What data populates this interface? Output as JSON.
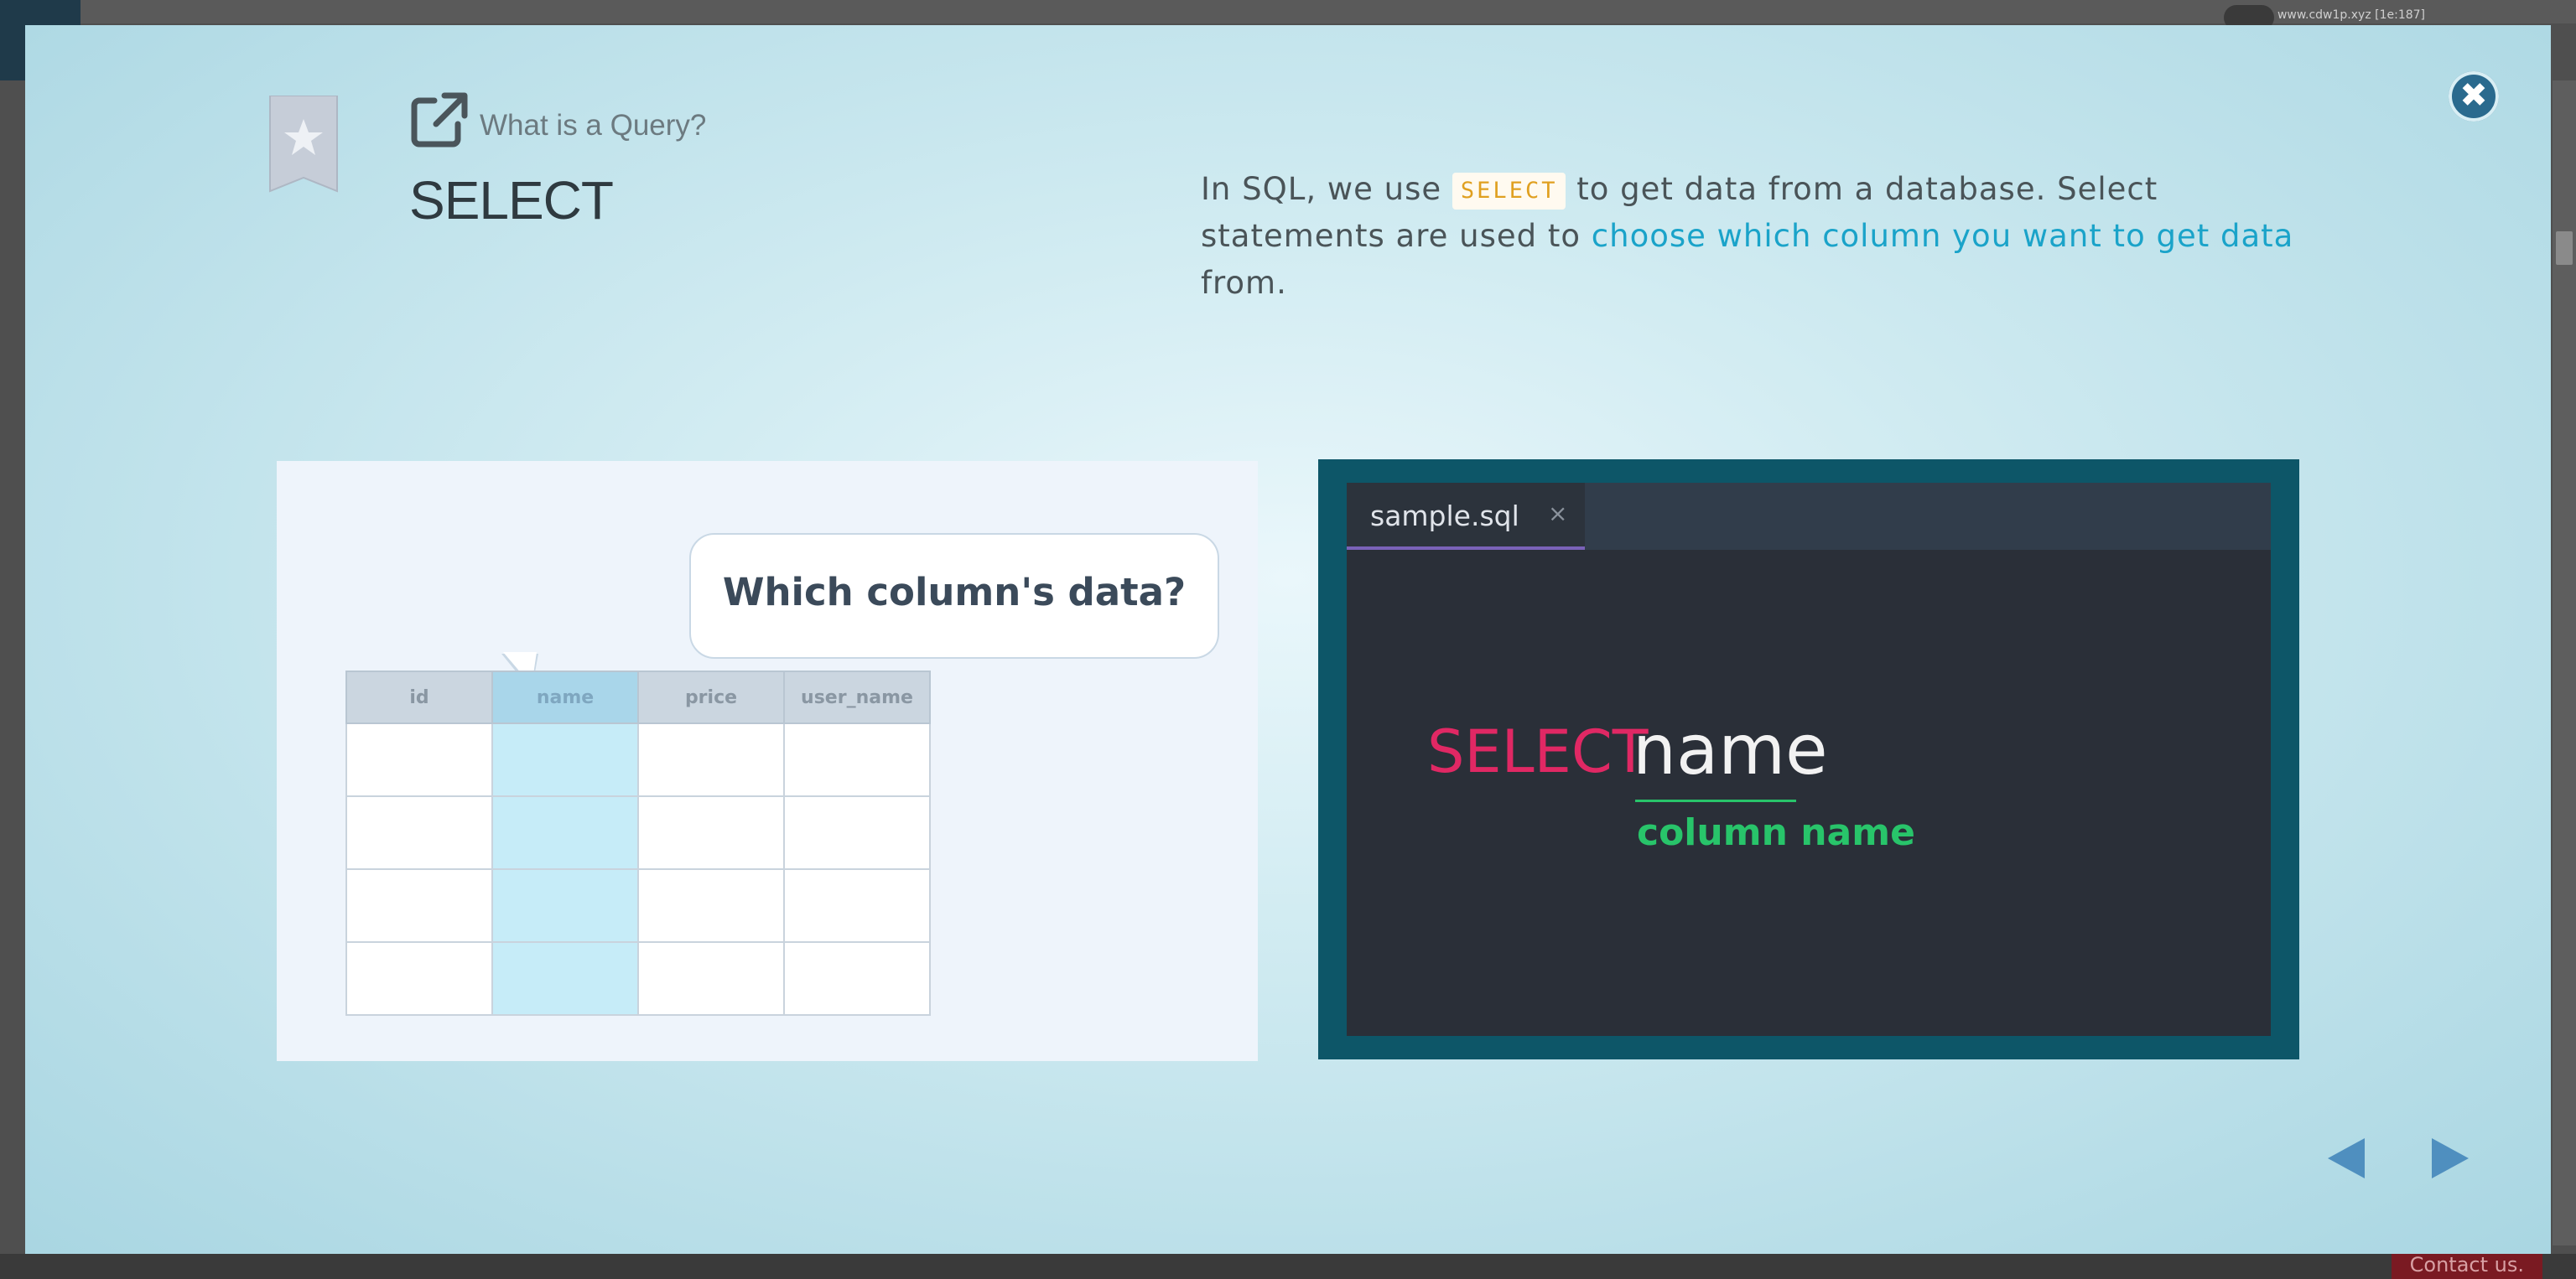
{
  "background_app": {
    "user_label": "www.cdw1p.xyz [1e:187]",
    "contact_label": "Contact us."
  },
  "modal": {
    "breadcrumb": "What is a Query?",
    "title": "SELECT",
    "description": {
      "part1": "In SQL, we use ",
      "keyword": "SELECT",
      "part2": " to get data from a database. Select statements are used to ",
      "highlight": "choose which column you want to get data",
      "part3": " from."
    },
    "illustration": {
      "bubble_text": "Which column's data?",
      "columns": [
        "id",
        "name",
        "price",
        "user_name"
      ],
      "selected_column": "name",
      "row_count": 4
    },
    "editor": {
      "tab_label": "sample.sql",
      "tab_close": "×",
      "code_keyword": "SELECT",
      "code_column": "name",
      "annotation": "column name"
    },
    "close_glyph": "✖",
    "colors": {
      "keyword_select": "#e02864",
      "annotation_green": "#28c46a",
      "highlight_blue": "#1aa3c9",
      "close_button": "#2a6a8e",
      "nav_arrow": "#4f8fbf"
    }
  }
}
